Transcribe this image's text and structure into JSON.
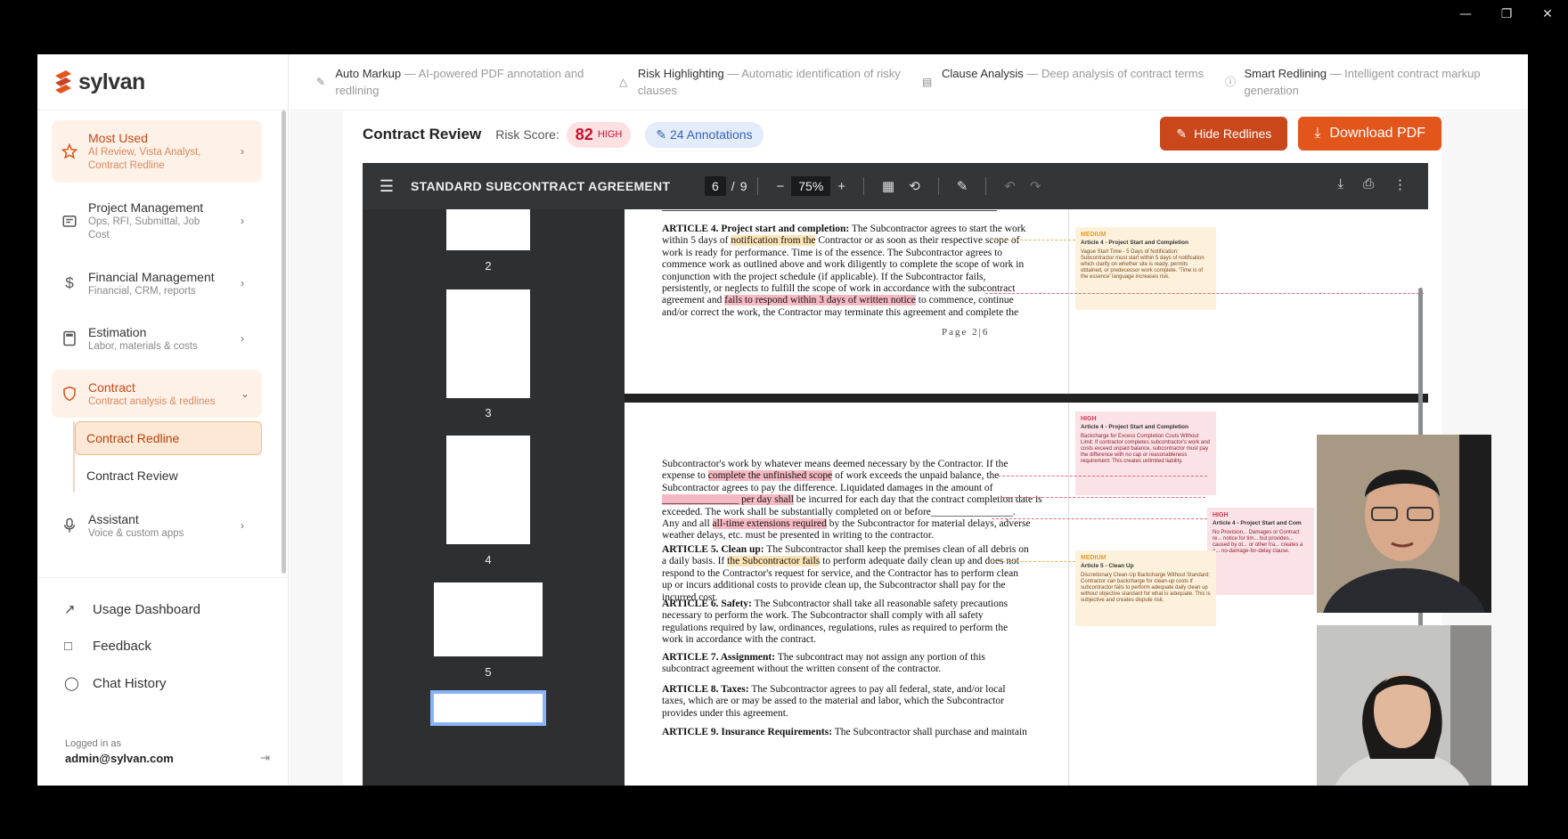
{
  "brand": {
    "name": "sylvan",
    "accent": "#e2561c"
  },
  "features": [
    {
      "icon": "pencil-icon",
      "name": "Auto Markup",
      "desc": "— AI-powered PDF annotation and redlining"
    },
    {
      "icon": "warning-icon",
      "name": "Risk Highlighting",
      "desc": "— Automatic identification of risky clauses"
    },
    {
      "icon": "document-icon",
      "name": "Clause Analysis",
      "desc": "— Deep analysis of contract terms"
    },
    {
      "icon": "info-icon",
      "name": "Smart Redlining",
      "desc": "— Intelligent contract markup generation"
    }
  ],
  "sidebar": {
    "items": [
      {
        "label": "Most Used",
        "sub": "AI Review, Vista Analyst, Contract Redline"
      },
      {
        "label": "Project Management",
        "sub": "Ops, RFI, Submittal, Job Cost"
      },
      {
        "label": "Financial Management",
        "sub": "Financial, CRM, reports"
      },
      {
        "label": "Estimation",
        "sub": "Labor, materials & costs"
      },
      {
        "label": "Contract",
        "sub": "Contract analysis & redlines"
      },
      {
        "label": "Assistant",
        "sub": "Voice & custom apps"
      }
    ],
    "contract_sub": [
      "Contract Redline",
      "Contract Review"
    ],
    "bottom": [
      "Usage Dashboard",
      "Feedback",
      "Chat History"
    ],
    "login_label": "Logged in as",
    "login_user": "admin@sylvan.com"
  },
  "review": {
    "title": "Contract Review",
    "risk_label": "Risk Score:",
    "risk_score": "82",
    "risk_level": "HIGH",
    "annotations": "24 Annotations",
    "hide_btn": "Hide Redlines",
    "download_btn": "Download PDF"
  },
  "pdf": {
    "doc_title": "STANDARD SUBCONTRACT AGREEMENT",
    "page_current": "6",
    "page_sep": "/",
    "page_total": "9",
    "zoom": "75%",
    "thumb_labels": [
      "2",
      "3",
      "4",
      "5"
    ],
    "page_footer": "Page 2|6"
  },
  "doc": {
    "p1": [
      "ARTICLE 4. Project start and completion:  The Subcontractor agrees to start the work",
      "within 5 days of notification from the Contractor or as soon as their respective scope of",
      "work is ready for performance. Time is of the essence. The Subcontractor agrees to",
      "commence work as outlined above and work diligently to complete the scope of work in",
      "conjunction with the project schedule (if applicable).  If the Subcontractor fails,",
      "persistently, or neglects to fulfill the scope of work in accordance with the subcontract",
      "agreement and fails to respond within 3 days of written notice to commence, continue",
      "and/or correct the work, the Contractor may terminate this agreement and complete the"
    ],
    "p2a": [
      "Subcontractor's work by whatever means deemed necessary by the Contractor. If the",
      "expense to complete the unfinished scope of work exceeds the unpaid balance, the",
      "Subcontractor agrees to pay the difference. Liquidated damages in the amount of",
      "_______________ per day shall be incurred for each day that the contract completion date is",
      "exceeded.  The work shall be substantially completed on or before________________.",
      "Any and all all-time extensions required by the Subcontractor for material delays, adverse",
      "weather delays, etc. must be presented in writing to the contractor."
    ],
    "p2b": [
      "ARTICLE 5. Clean up: The Subcontractor shall keep the premises clean of all debris on",
      "a daily basis.  If the Subcontractor fails to perform adequate daily clean up and does not",
      "respond to the Contractor's request for service, and the Contractor has to perform clean",
      "up or incurs additional costs to provide clean up, the Subcontractor shall pay for the",
      "incurred cost."
    ],
    "p2c": [
      "ARTICLE 6. Safety:  The Subcontractor shall take all reasonable safety precautions",
      "necessary to perform the work.  The Subcontractor shall comply with all safety",
      "regulations required by law, ordinances, regulations, rules as required to perform the",
      "work in accordance with the contract."
    ],
    "p2d": [
      "ARTICLE 7. Assignment:   The subcontract may not assign any portion of this",
      "subcontract agreement without the written consent of the contractor."
    ],
    "p2e": [
      "ARTICLE 8. Taxes:  The Subcontractor agrees to pay all federal, state, and/or local",
      "taxes, which are or may be assed to the material and labor, which the Subcontractor",
      "provides under this agreement."
    ],
    "p2f": [
      "ARTICLE 9. Insurance Requirements: The Subcontractor shall purchase and maintain"
    ]
  },
  "notes": [
    {
      "level": "MEDIUM",
      "title": "Article 4 - Project Start and Completion",
      "body": "Vague Start Time - 5 Days of Notification: Subcontractor must start within 5 days of notification which clarify on whether site is ready, permits obtained, or predecessor work complete. 'Time is of the essence' language increases risk."
    },
    {
      "level": "HIGH",
      "title": "Article 4 - Project Start and Completion",
      "body": "Backcharge for Excess Completion Costs Without Limit: If contractor completes subcontractor's work and costs exceed unpaid balance, subcontractor must pay the difference with no cap or reasonableness requirement. This creates unlimited liability."
    },
    {
      "level": "HIGH",
      "title": "Article 4 - Project Start and Com",
      "body": "No Provision... Damages or Contract re... notice for tim... but provides... caused by ot... or other tra... creates a o... no-damage-for-delay clause."
    },
    {
      "level": "MEDIUM",
      "title": "Article 5 - Clean Up",
      "body": "Discretionary Clean-Up Backcharge Without Standard: Contractor can backcharge for clean-up costs if subcontractor fails to perform adequate daily clean up without objective standard for what is adequate. This is subjective and creates dispute risk."
    }
  ]
}
